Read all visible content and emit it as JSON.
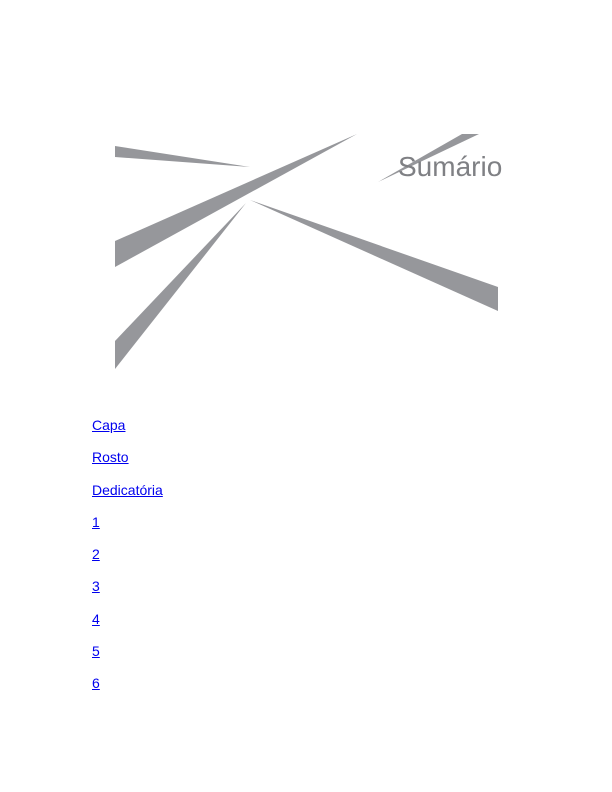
{
  "page": {
    "title": "Sumário"
  },
  "toc": {
    "items": [
      {
        "label": "Capa"
      },
      {
        "label": "Rosto"
      },
      {
        "label": "Dedicatória"
      },
      {
        "label": "1"
      },
      {
        "label": "2"
      },
      {
        "label": "3"
      },
      {
        "label": "4"
      },
      {
        "label": "5"
      },
      {
        "label": "6"
      }
    ]
  },
  "colors": {
    "decoration": "#96979b",
    "title": "#7f8084",
    "link": "#0000ee"
  }
}
